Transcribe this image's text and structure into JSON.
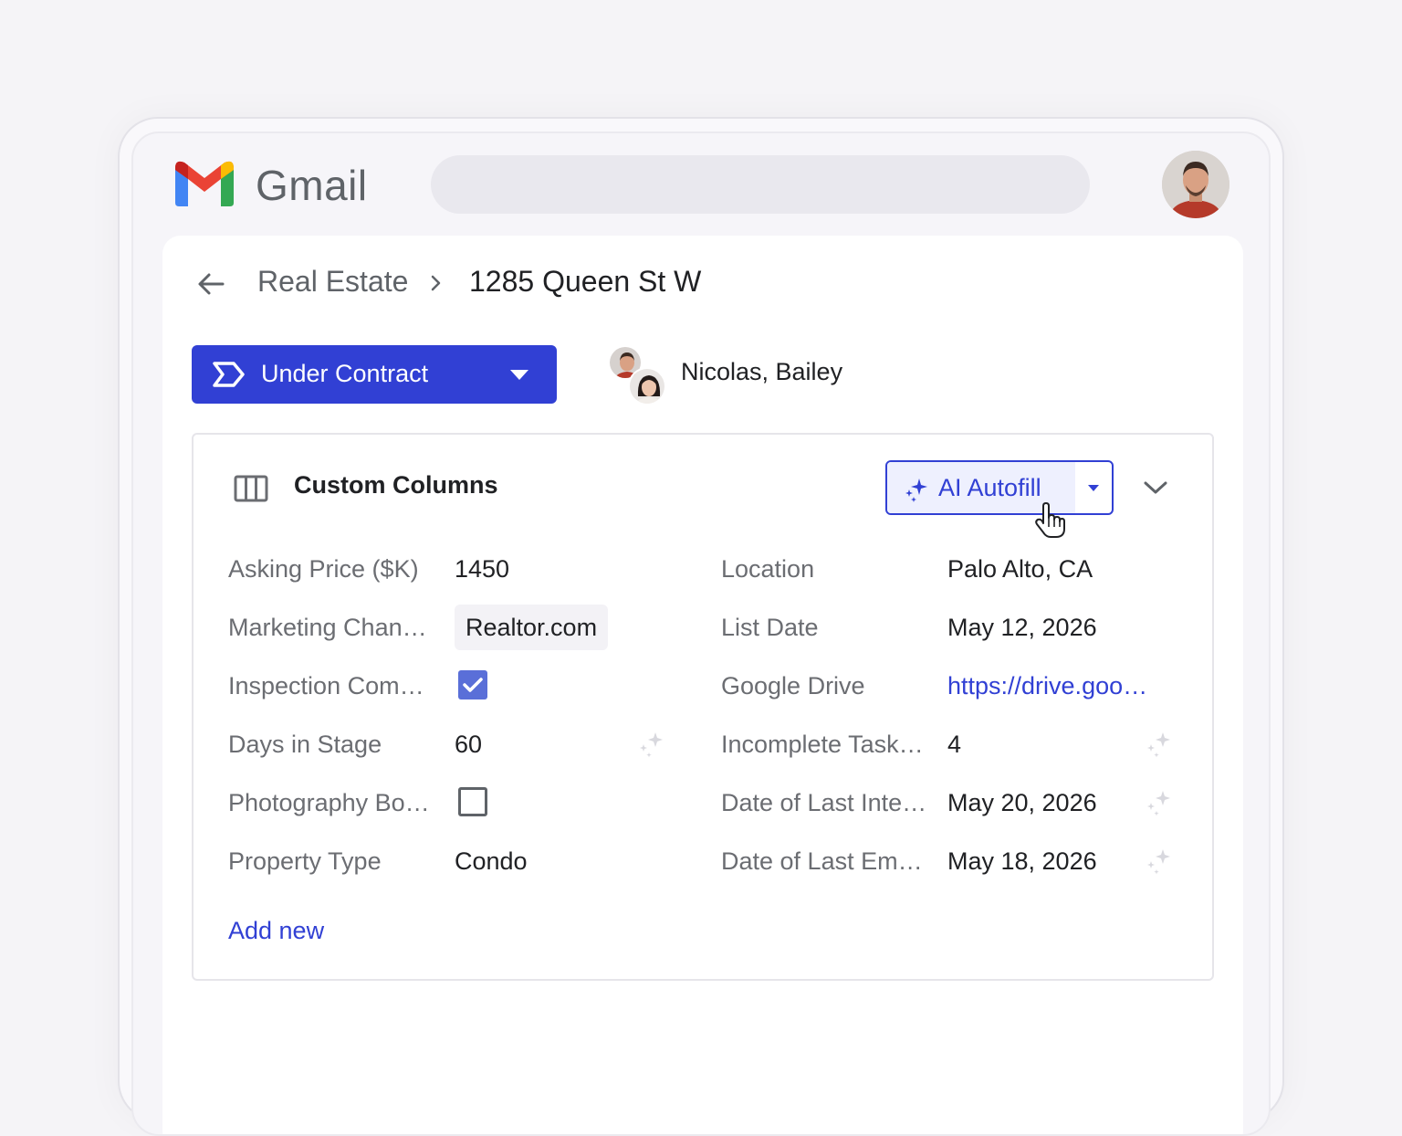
{
  "app": {
    "name": "Gmail"
  },
  "breadcrumb": {
    "parent": "Real Estate",
    "current": "1285 Queen St W"
  },
  "stage": {
    "label": "Under Contract",
    "color": "#3140d4"
  },
  "assignees": {
    "label": "Nicolas, Bailey"
  },
  "panel": {
    "title": "Custom Columns",
    "ai_button_label": "AI Autofill",
    "add_new_label": "Add new"
  },
  "fields_left": [
    {
      "label": "Asking Price ($K)",
      "value": "1450"
    },
    {
      "label": "Marketing Chan…",
      "value": "Realtor.com"
    },
    {
      "label": "Inspection Com…",
      "value": "checked"
    },
    {
      "label": "Days in Stage",
      "value": "60"
    },
    {
      "label": "Photography Bo…",
      "value": "unchecked"
    },
    {
      "label": "Property Type",
      "value": "Condo"
    }
  ],
  "fields_right": [
    {
      "label": "Location",
      "value": "Palo Alto, CA"
    },
    {
      "label": "List Date",
      "value": "May 12, 2026"
    },
    {
      "label": "Google Drive",
      "value": "https://drive.goo…"
    },
    {
      "label": "Incomplete Task…",
      "value": "4"
    },
    {
      "label": "Date of Last Inte…",
      "value": "May 20, 2026"
    },
    {
      "label": "Date of Last Em…",
      "value": "May 18, 2026"
    }
  ],
  "icons": {
    "logo": "gmail-logo-icon",
    "back": "arrow-left-icon",
    "stage": "pipeline-stage-icon",
    "columns": "columns-icon",
    "ai": "sparkle-icon",
    "collapse": "chevron-down-icon"
  },
  "colors": {
    "accent": "#3140d4",
    "checkbox": "#5a6fd8"
  }
}
